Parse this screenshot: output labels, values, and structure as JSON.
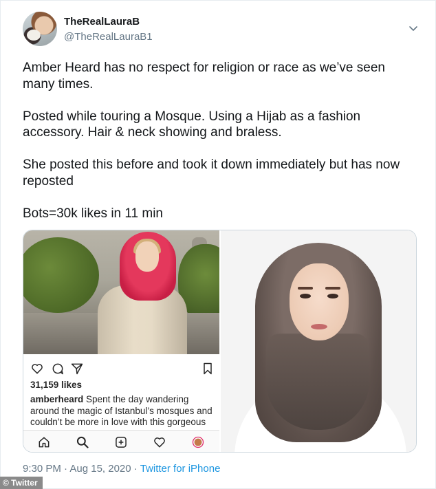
{
  "tweet": {
    "author": {
      "display_name": "TheRealLauraB",
      "handle": "@TheRealLauraB1"
    },
    "paragraphs": [
      "Amber Heard has no respect for religion or race as we’ve seen many times.",
      "Posted while touring a Mosque. Using a Hijab as a fashion accessory. Hair & neck showing and braless.",
      "She posted this before and took it down immediately but has now reposted",
      "Bots=30k likes in 11 min"
    ],
    "timestamp": "9:30 PM · Aug 15, 2020",
    "separator": " · ",
    "source": "Twitter for iPhone",
    "menu_icon": "chevron-down-icon"
  },
  "instagram_post": {
    "likes": "31,159 likes",
    "caption_user": "amberheard",
    "caption_text": " Spent the day wandering around the magic of Istanbul’s mosques and couldn’t be more in love with this gorgeous city",
    "action_icons": [
      "heart-icon",
      "comment-icon",
      "share-icon",
      "bookmark-icon"
    ],
    "nav_icons": [
      "home-icon",
      "search-icon",
      "add-post-icon",
      "activity-heart-icon",
      "profile-icon"
    ]
  },
  "watermark": "© Twitter",
  "colors": {
    "text": "#14171a",
    "muted": "#657786",
    "link": "#1b95e0",
    "border": "#ccd6dd"
  }
}
